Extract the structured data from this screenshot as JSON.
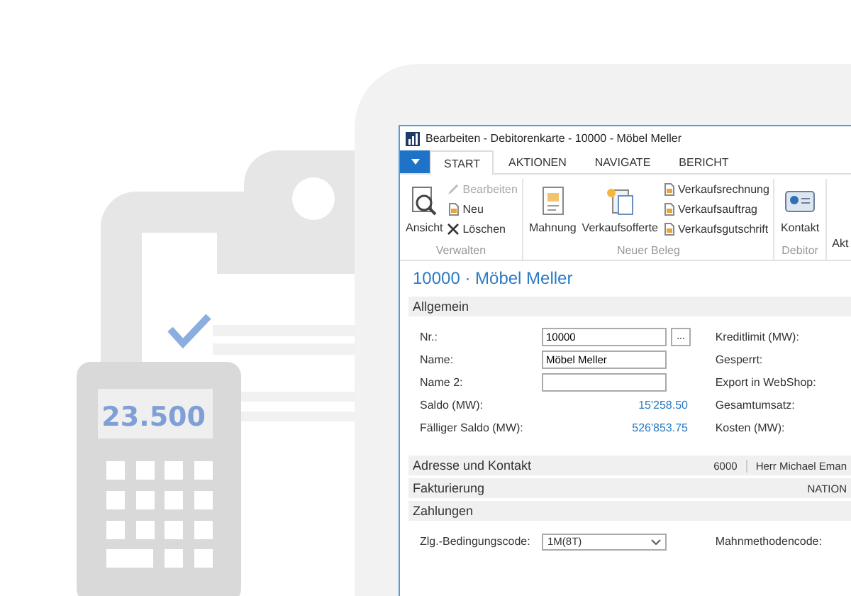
{
  "illustration": {
    "calculator_display": "23.500"
  },
  "window": {
    "title": "Bearbeiten - Debitorenkarte - 10000 - Möbel Meller"
  },
  "tabs": [
    {
      "label": "START",
      "selected": true
    },
    {
      "label": "AKTIONEN",
      "selected": false
    },
    {
      "label": "NAVIGATE",
      "selected": false
    },
    {
      "label": "BERICHT",
      "selected": false
    }
  ],
  "ribbon": [
    {
      "label": "Verwalten",
      "items": [
        {
          "label": "Ansicht",
          "kind": "large",
          "disabled": false
        },
        {
          "label": "Bearbeiten",
          "kind": "small",
          "disabled": true
        },
        {
          "label": "Neu",
          "kind": "small",
          "disabled": false
        },
        {
          "label": "Löschen",
          "kind": "small",
          "disabled": false
        }
      ]
    },
    {
      "label": "Neuer Beleg",
      "items": [
        {
          "label": "Mahnung",
          "kind": "large",
          "disabled": false
        },
        {
          "label": "Verkaufsofferte",
          "kind": "large",
          "disabled": false
        },
        {
          "label": "Verkaufsrechnung",
          "kind": "small",
          "disabled": false
        },
        {
          "label": "Verkaufsauftrag",
          "kind": "small",
          "disabled": false
        },
        {
          "label": "Verkaufsgutschrift",
          "kind": "small",
          "disabled": false
        }
      ]
    },
    {
      "label": "Debitor",
      "items": [
        {
          "label": "Kontakt",
          "kind": "large",
          "disabled": false
        }
      ]
    },
    {
      "items": [
        {
          "label": "Akt",
          "kind": "large",
          "disabled": false
        }
      ]
    }
  ],
  "page_title": "10000 · Möbel Meller",
  "sections": [
    {
      "title": "Allgemein",
      "fields_left": [
        {
          "label": "Nr.:",
          "kind": "lookup",
          "value": "10000",
          "button": "..."
        },
        {
          "label": "Name:",
          "kind": "input",
          "value": "Möbel Meller"
        },
        {
          "label": "Name 2:",
          "kind": "input"
        },
        {
          "label": "Saldo (MW):",
          "kind": "amount",
          "value": "15'258.50"
        },
        {
          "label": "Fälliger Saldo (MW):",
          "kind": "amount",
          "value": "526'853.75"
        }
      ],
      "fields_right": [
        {
          "label": "Kreditlimit (MW):"
        },
        {
          "label": "Gesperrt:"
        },
        {
          "label": "Export in WebShop:"
        },
        {
          "label": "Gesamtumsatz:"
        },
        {
          "label": "Kosten (MW):"
        }
      ]
    },
    {
      "title": "Adresse und Kontakt",
      "summary": [
        "6000",
        "Herr Michael Eman"
      ]
    },
    {
      "title": "Fakturierung",
      "summary": [
        "NATION"
      ]
    },
    {
      "title": "Zahlungen",
      "fields_left": [
        {
          "label": "Zlg.-Bedingungscode:",
          "kind": "dropdown",
          "value": "1M(8T)"
        }
      ],
      "fields_right": [
        {
          "label": "Mahnmethodencode:"
        }
      ]
    }
  ]
}
